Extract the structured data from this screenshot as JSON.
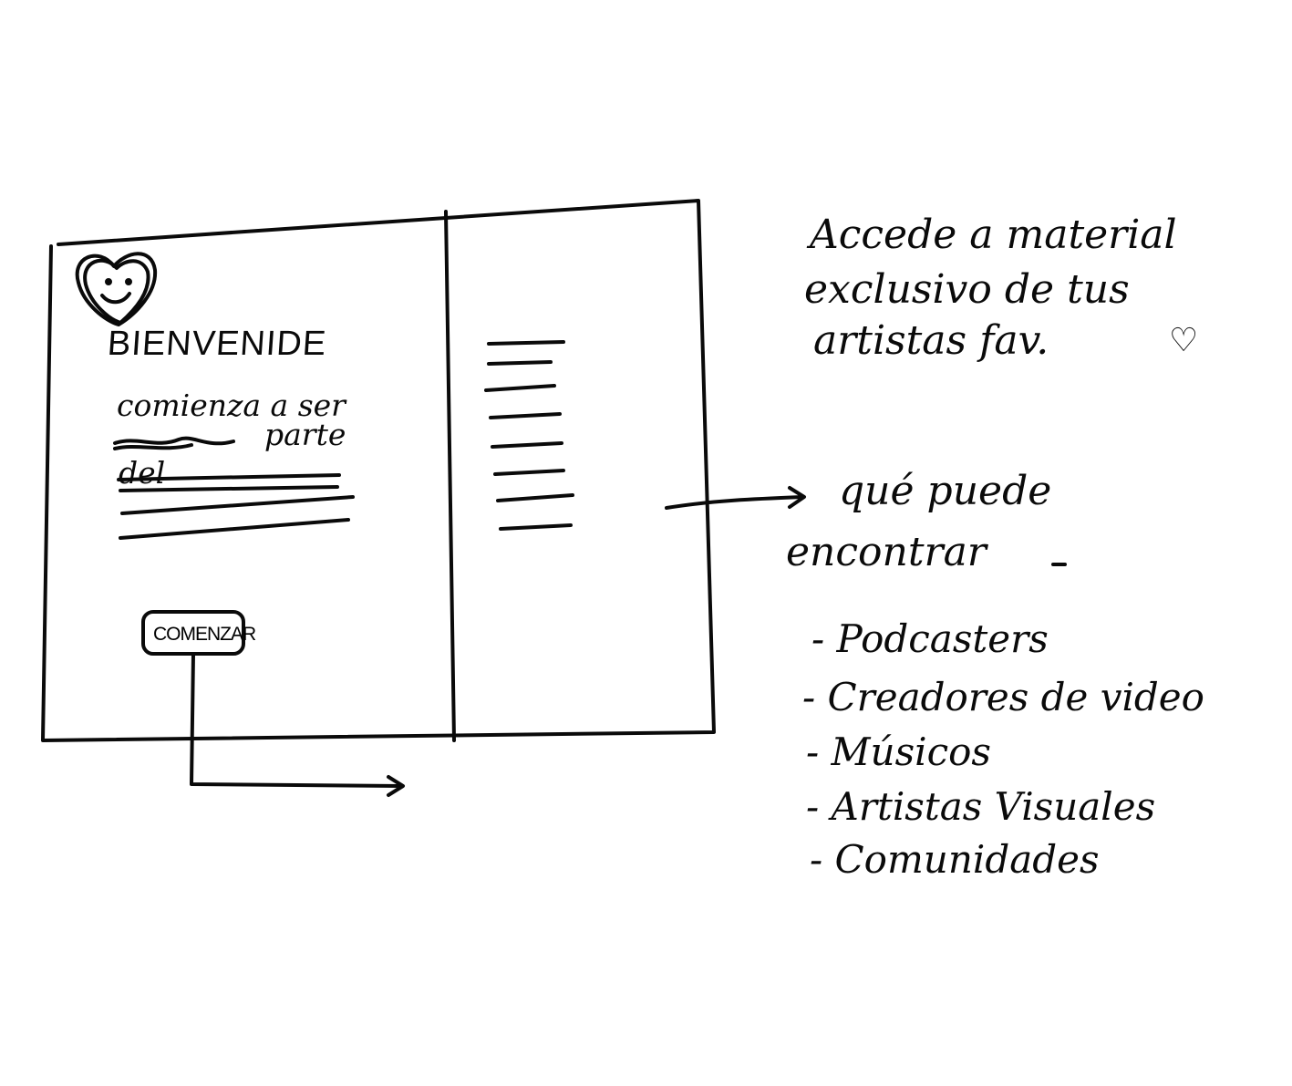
{
  "screen": {
    "logo_icon": "smiling-heart-icon",
    "welcome_title": "BIENVENIDE",
    "intro_lines": [
      "comienza a ser",
      "parte",
      "del"
    ],
    "start_button_label": "COMENZAR",
    "menu_panel_icon": "menu-lines-icon"
  },
  "annotations": {
    "access_note_lines": [
      "Accede a material",
      "exclusivo de tus",
      "artistas fav."
    ],
    "access_note_icon": "heart-icon",
    "content_heading_lines": [
      "qué puede",
      "encontrar"
    ],
    "content_types": [
      "- Podcasters",
      "- Creadores de video",
      "- Músicos",
      "- Artistas Visuales",
      "- Comunidades"
    ]
  },
  "colors": {
    "ink": "#0a0a0a",
    "paper": "#ffffff"
  }
}
